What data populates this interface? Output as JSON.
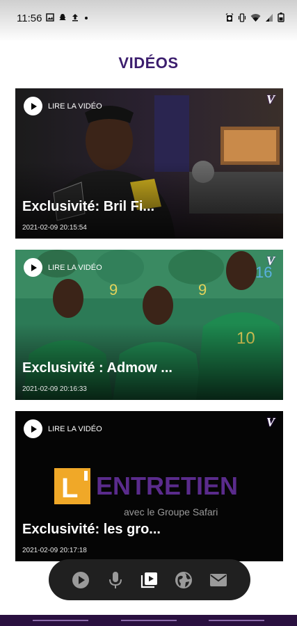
{
  "status_bar": {
    "time": "11:56",
    "left_icons": [
      "image-icon",
      "snapchat-icon",
      "upload-icon",
      "dot-icon"
    ],
    "right_icons": [
      "alarm-icon",
      "vibrate-icon",
      "wifi-icon",
      "signal-icon",
      "battery-icon"
    ]
  },
  "header": {
    "title": "VIDÉOS"
  },
  "videos": [
    {
      "play_label": "LIRE LA VIDÉO",
      "title": "Exclusivité: Bril Fi...",
      "date": "2021-02-09 20:15:54",
      "badge": "V"
    },
    {
      "play_label": "LIRE LA VIDÉO",
      "title": "Exclusivité : Admow ...",
      "date": "2021-02-09 20:16:33",
      "badge": "V"
    },
    {
      "play_label": "LIRE LA VIDÉO",
      "title": "Exclusivité: les gro...",
      "date": "2021-02-09 20:17:18",
      "badge": "V"
    }
  ],
  "entretien": {
    "logo_text": "ENTRETIEN",
    "subtitle": "avec le Groupe Safari"
  },
  "bottom_nav": {
    "items": [
      "play-icon",
      "microphone-icon",
      "video-library-icon",
      "globe-icon",
      "mail-icon"
    ]
  },
  "colors": {
    "title": "#3c1e6e",
    "accent_purple": "#6a2fb0",
    "nav_bg": "#202020"
  }
}
